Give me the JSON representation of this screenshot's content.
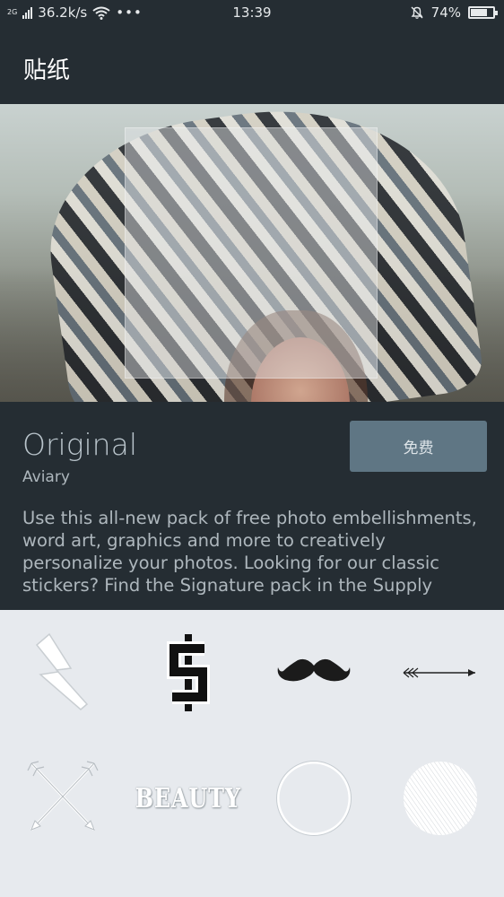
{
  "status_bar": {
    "network_type": "2G",
    "speed": "36.2k/s",
    "more": "•••",
    "time": "13:39",
    "battery": "74%",
    "battery_level": 0.74
  },
  "header": {
    "title": "贴纸"
  },
  "pack": {
    "name": "Original",
    "author": "Aviary",
    "price_label": "免费",
    "description": "Use this all-new pack of free photo embellishments, word art, graphics and more to creatively personalize your photos. Looking for our classic stickers? Find the Signature pack in the Supply"
  },
  "stickers": [
    {
      "icon": "lightning-bolt-sticker"
    },
    {
      "icon": "dollar-sign-sticker"
    },
    {
      "icon": "mustache-sticker"
    },
    {
      "icon": "arrow-sticker"
    },
    {
      "icon": "crossed-arrows-sticker"
    },
    {
      "icon": "beauty-text-sticker",
      "text": "BEAUTY"
    },
    {
      "icon": "circle-outline-sticker"
    },
    {
      "icon": "hatched-circle-sticker"
    }
  ],
  "colors": {
    "dark_bg": "#252d33",
    "button": "#5f7684",
    "grid_bg": "#e7eaee"
  }
}
